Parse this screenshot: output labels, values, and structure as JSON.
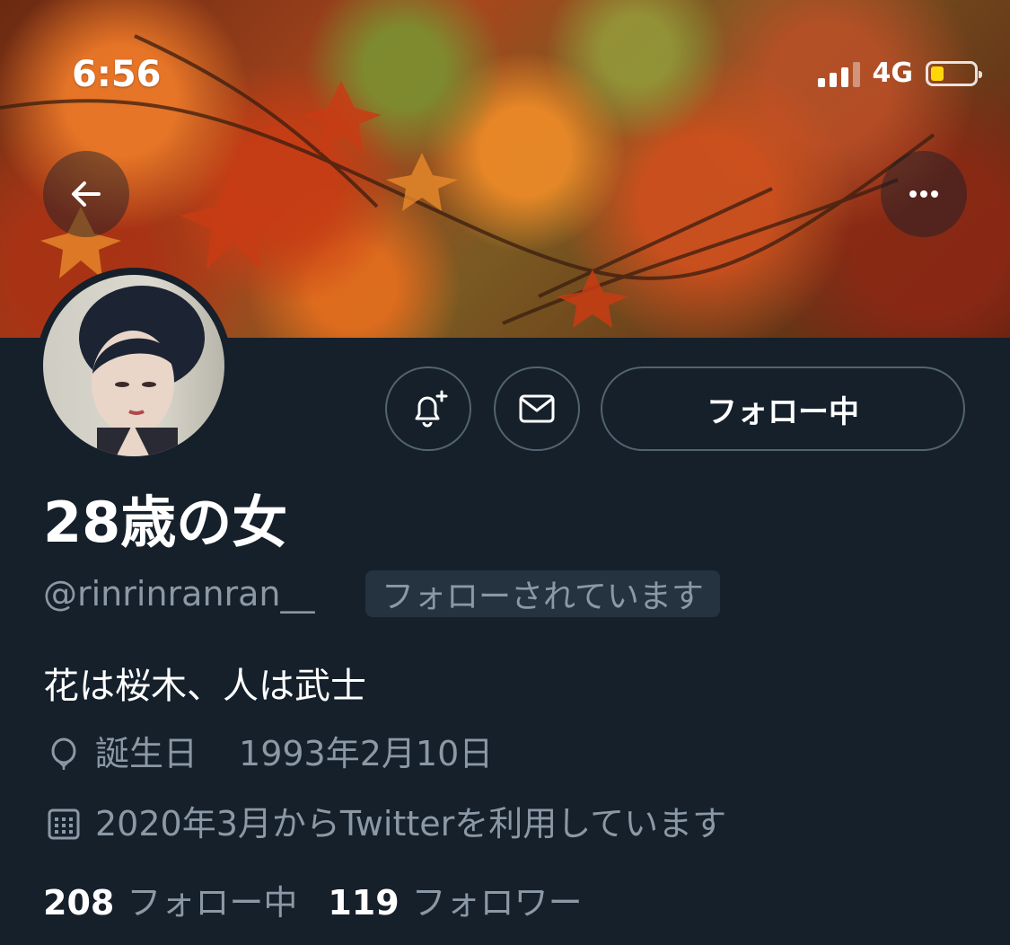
{
  "status_bar": {
    "time": "6:56",
    "network": "4G",
    "battery_level": 0.2
  },
  "header": {
    "back_icon": "arrow-left-icon",
    "more_icon": "ellipsis-icon"
  },
  "actions": {
    "notify_icon": "bell-plus-icon",
    "message_icon": "envelope-icon",
    "follow_label": "フォロー中"
  },
  "profile": {
    "name": "28歳の女",
    "handle": "@rinrinranran__",
    "follows_you": "フォローされています",
    "bio": "花は桜木、人は武士",
    "birthday_label": "誕生日",
    "birthday_value": "1993年2月10日",
    "joined": "2020年3月からTwitterを利用しています"
  },
  "stats": {
    "following_count": "208",
    "following_label": "フォロー中",
    "followers_count": "119",
    "followers_label": "フォロワー"
  },
  "colors": {
    "background": "#15202b",
    "secondary_text": "#8b98a5",
    "border": "#536471",
    "badge_bg": "#253341",
    "battery": "#ffd60a"
  }
}
